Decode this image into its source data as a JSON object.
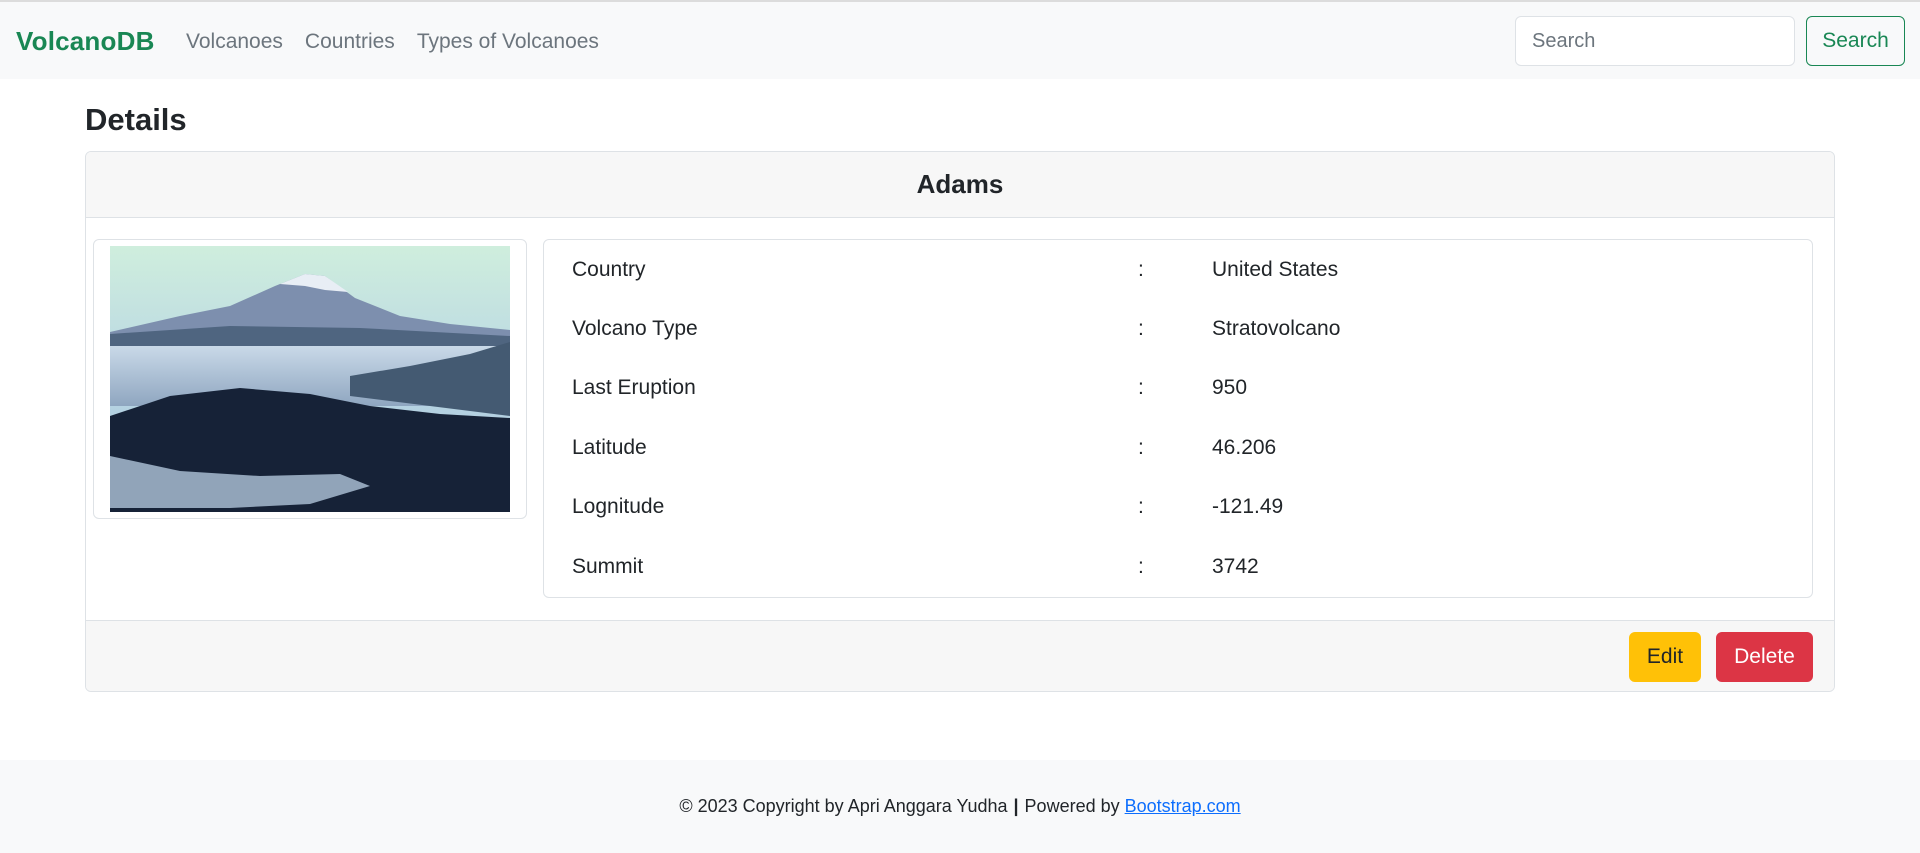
{
  "navbar": {
    "brand": "VolcanoDB",
    "links": [
      "Volcanoes",
      "Countries",
      "Types of Volcanoes"
    ],
    "search_placeholder": "Search",
    "search_button": "Search"
  },
  "page": {
    "title": "Details"
  },
  "volcano": {
    "name": "Adams",
    "details": [
      {
        "label": "Country",
        "sep": ":",
        "value": "United States"
      },
      {
        "label": "Volcano Type",
        "sep": ":",
        "value": "Stratovolcano"
      },
      {
        "label": "Last Eruption",
        "sep": ":",
        "value": "950"
      },
      {
        "label": "Latitude",
        "sep": ":",
        "value": "46.206"
      },
      {
        "label": "Lognitude",
        "sep": ":",
        "value": "-121.49"
      },
      {
        "label": "Summit",
        "sep": ":",
        "value": "3742"
      }
    ]
  },
  "actions": {
    "edit": "Edit",
    "delete": "Delete"
  },
  "footer": {
    "copyright": "© 2023 Copyright by Apri Anggara Yudha",
    "separator": "|",
    "powered": "Powered by",
    "link": "Bootstrap.com"
  },
  "colors": {
    "brand": "#198754",
    "warning": "#ffc107",
    "danger": "#dc3545",
    "link": "#0d6efd"
  }
}
